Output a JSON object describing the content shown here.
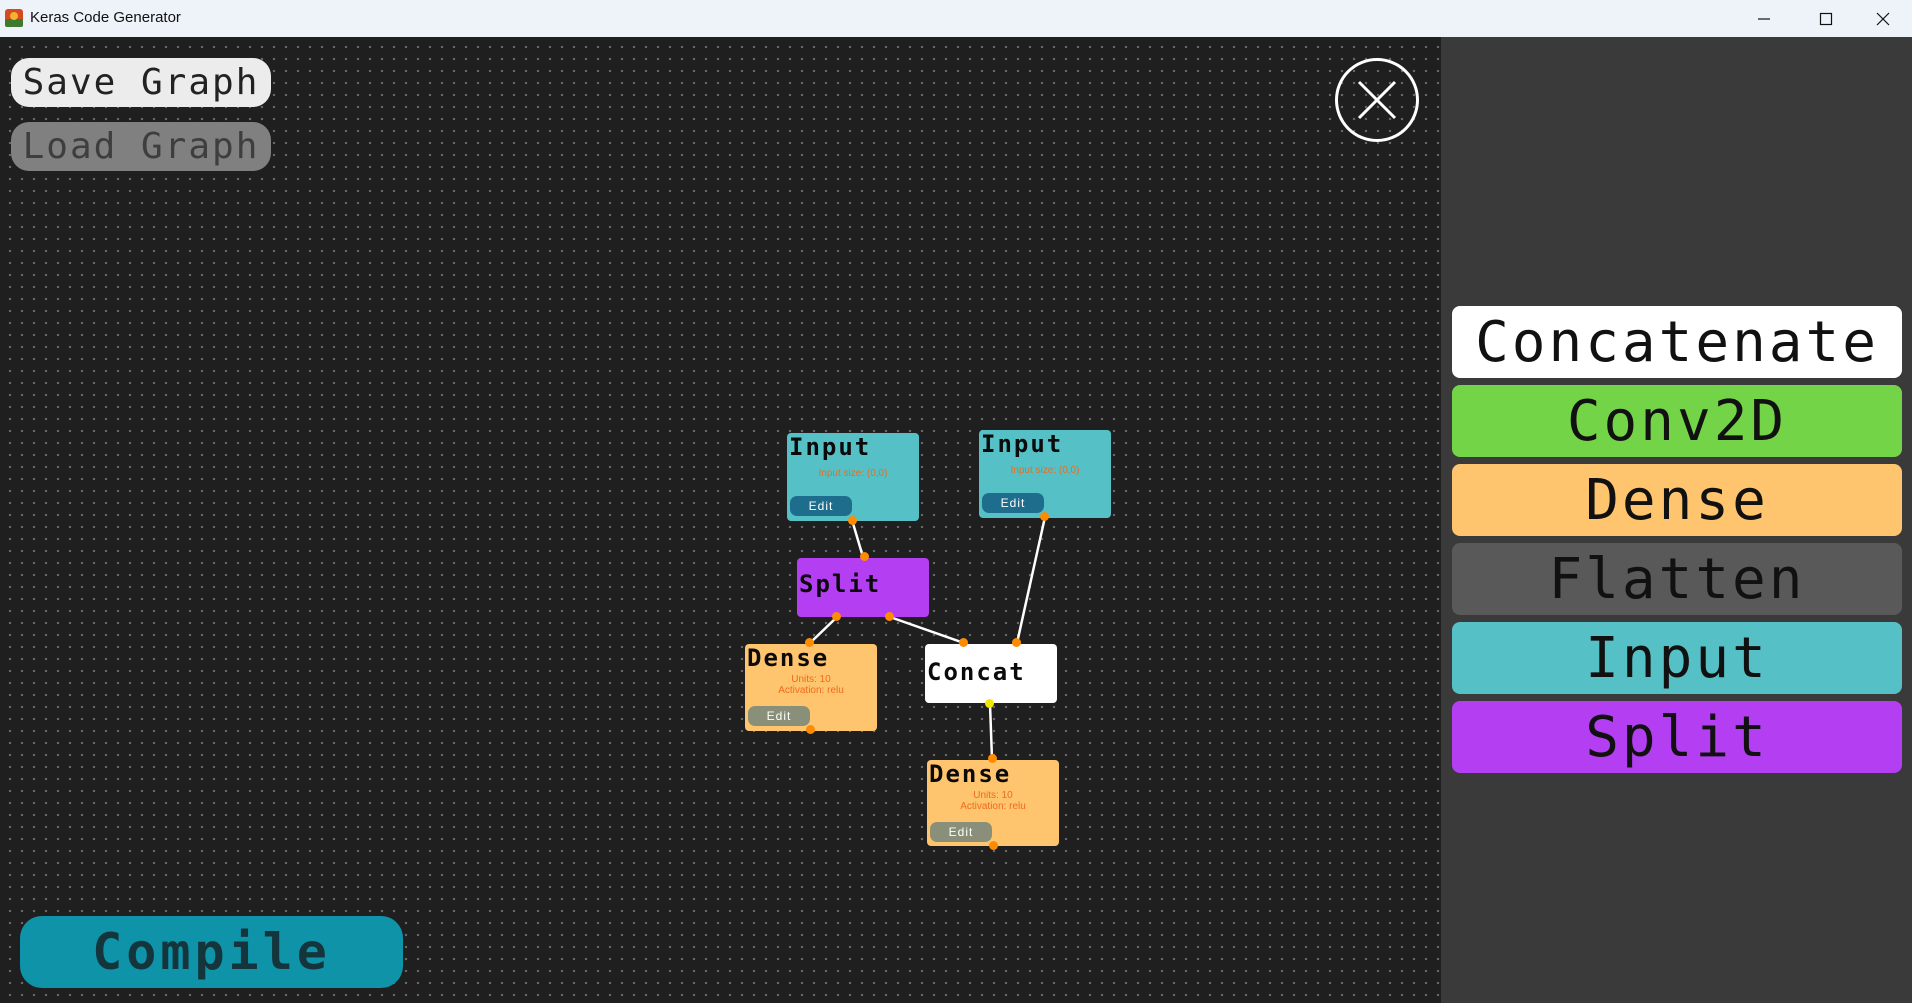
{
  "window": {
    "title": "Keras Code Generator",
    "minimize": "—",
    "maximize": "☐",
    "close": "✕"
  },
  "toolbar": {
    "save_label": "Save Graph",
    "load_label": "Load Graph",
    "compile_label": "Compile"
  },
  "palette": [
    {
      "label": "Concatenate",
      "color": "#ffffff"
    },
    {
      "label": "Conv2D",
      "color": "#74d448"
    },
    {
      "label": "Dense",
      "color": "#ffc46e"
    },
    {
      "label": "Flatten",
      "color": "#595959"
    },
    {
      "label": "Input",
      "color": "#55c1c6"
    },
    {
      "label": "Split",
      "color": "#b43ef2"
    }
  ],
  "nodes": {
    "input1": {
      "title": "Input",
      "info": "Input size: (0,0)",
      "edit": "Edit",
      "color": "#55c1c6"
    },
    "input2": {
      "title": "Input",
      "info": "Input size: (0,0)",
      "edit": "Edit",
      "color": "#55c1c6"
    },
    "split": {
      "title": "Split",
      "color": "#b43ef2"
    },
    "dense1": {
      "title": "Dense",
      "info_units": "Units: 10",
      "info_activation": "Activation: relu",
      "edit": "Edit",
      "color": "#ffc46e"
    },
    "concat": {
      "title": "Concat",
      "color": "#ffffff"
    },
    "dense2": {
      "title": "Dense",
      "info_units": "Units: 10",
      "info_activation": "Activation: relu",
      "edit": "Edit",
      "color": "#ffc46e"
    }
  },
  "icons": {
    "app": "keras-app-icon",
    "close_canvas": "close-circle-icon"
  }
}
